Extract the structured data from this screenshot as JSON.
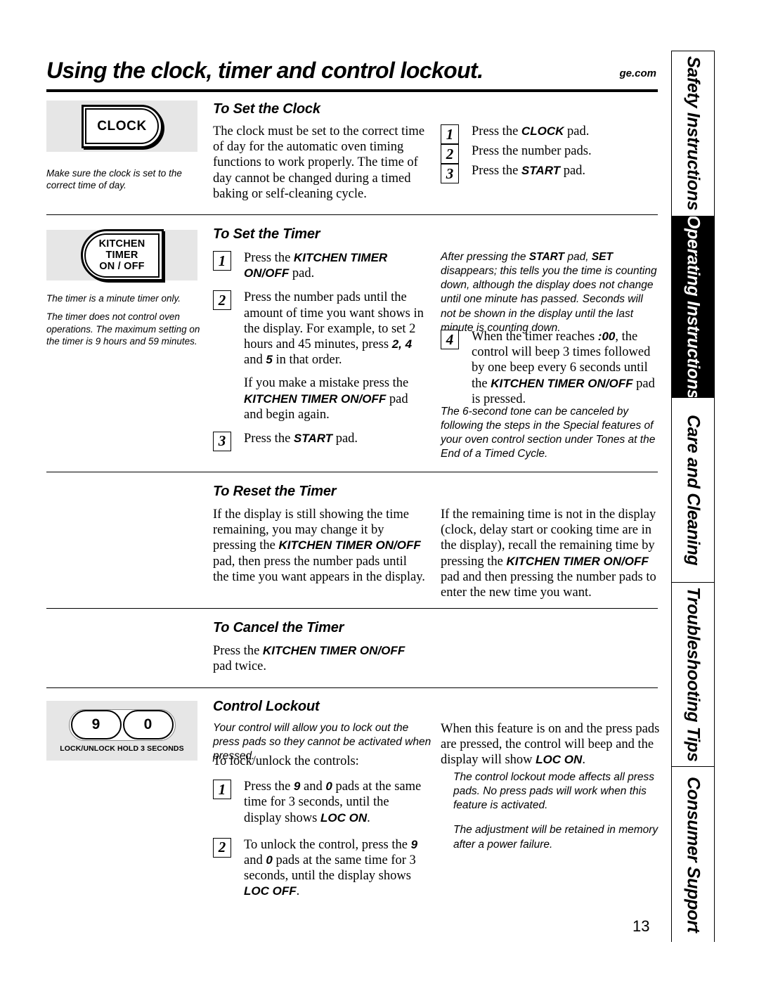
{
  "header": {
    "title": "Using the clock, timer and control lockout.",
    "site": "ge.com"
  },
  "tabs": [
    {
      "label": "Safety Instructions",
      "active": false
    },
    {
      "label": "Operating Instructions",
      "active": true
    },
    {
      "label": "Care and Cleaning",
      "active": false
    },
    {
      "label": "Troubleshooting Tips",
      "active": false
    },
    {
      "label": "Consumer Support",
      "active": false
    }
  ],
  "clock_section": {
    "pad_label": "CLOCK",
    "note": "Make sure the clock is set to the correct time of day.",
    "heading": "To Set the Clock",
    "body": "The clock must be set to the correct time of day for the automatic oven timing functions to work properly. The time of day cannot be changed during a timed baking or self-cleaning cycle.",
    "steps": [
      {
        "num": "1",
        "text_before": "Press the ",
        "pad": "CLOCK",
        "text_after": " pad."
      },
      {
        "num": "2",
        "text_before": "Press the number pads.",
        "pad": "",
        "text_after": ""
      },
      {
        "num": "3",
        "text_before": "Press the ",
        "pad": "START",
        "text_after": " pad."
      }
    ]
  },
  "timer_section": {
    "pad_label_line1": "KITCHEN",
    "pad_label_line2": "TIMER",
    "pad_label_line3": "ON / OFF",
    "note1": "The timer is a minute timer only.",
    "note2": "The timer does not control oven operations. The maximum setting on the timer is 9 hours and 59 minutes.",
    "heading": "To Set the Timer",
    "step1_pre": "Press the ",
    "step1_pad": "KITCHEN TIMER ON/OFF",
    "step1_post": " pad.",
    "step2_a_pre": "Press the number pads until the amount of time you want shows in the display. For example, to set 2 hours and 45 minutes, press ",
    "step2_a_pad": "2, 4",
    "step2_a_mid": " and ",
    "step2_a_pad2": "5",
    "step2_a_post": " in that order.",
    "step2_b_pre": "If you make a mistake press the ",
    "step2_b_pad": "KITCHEN TIMER ON/OFF",
    "step2_b_post": " pad and begin again.",
    "step3_pre": "Press the ",
    "step3_pad": "START",
    "step3_post": " pad.",
    "right_note_pre": "After pressing the ",
    "right_note_pad1": "START",
    "right_note_mid1": " pad, ",
    "right_note_pad2": "SET",
    "right_note_post": " disappears; this tells you the time is counting down, although the display does not change until one minute has passed. Seconds will not be shown in the display until the last minute is counting down.",
    "step4_pre": "When the timer reaches ",
    "step4_pad": ":00",
    "step4_mid": ", the control will beep 3 times followed by one beep every 6 seconds until the ",
    "step4_pad2": "KITCHEN TIMER ON/OFF",
    "step4_post": " pad is pressed.",
    "tone_note": "The 6-second tone can be canceled by following the steps in the Special features of your oven control section under Tones at the End of a Timed Cycle."
  },
  "reset_section": {
    "heading": "To Reset the Timer",
    "left_pre": "If the display is still showing the time remaining, you may change it by pressing the ",
    "left_pad": "KITCHEN TIMER ON/OFF",
    "left_post": " pad, then press the number pads until the time you want appears in the display.",
    "right_pre": "If the remaining time is not in the display (clock, delay start or cooking time are in the display), recall the remaining time by pressing the ",
    "right_pad": "KITCHEN TIMER ON/OFF",
    "right_post": " pad and then pressing the number pads to enter the new time you want."
  },
  "cancel_section": {
    "heading": "To Cancel the Timer",
    "pre": "Press the ",
    "pad": "KITCHEN TIMER ON/OFF",
    "post": " pad twice."
  },
  "lockout_section": {
    "key9": "9",
    "key0": "0",
    "pad_caption": "LOCK/UNLOCK HOLD 3 SECONDS",
    "heading": "Control Lockout",
    "intro_note": "Your control will allow you to lock out the press pads so they cannot be activated when pressed.",
    "lead": "To lock/unlock the controls:",
    "step1_pre": "Press the ",
    "step1_pad": "9",
    "step1_mid": " and ",
    "step1_pad2": "0",
    "step1_post": " pads at the same time for 3 seconds, until the display shows ",
    "step1_pad3": "LOC ON",
    "step1_end": ".",
    "step2_pre": "To unlock the control, press the ",
    "step2_pad": "9",
    "step2_mid": " and ",
    "step2_pad2": "0",
    "step2_post": " pads at the same time for 3 seconds, until the display shows ",
    "step2_pad3": "LOC OFF",
    "step2_end": ".",
    "right_pre": "When this feature is on and the press pads are pressed, the control will beep and the display will show ",
    "right_pad": "LOC ON",
    "right_post": ".",
    "right_note1": "The control lockout mode affects all press pads. No press pads will work when this feature is activated.",
    "right_note2": "The adjustment will be retained in memory after a power failure."
  },
  "page_number": "13"
}
